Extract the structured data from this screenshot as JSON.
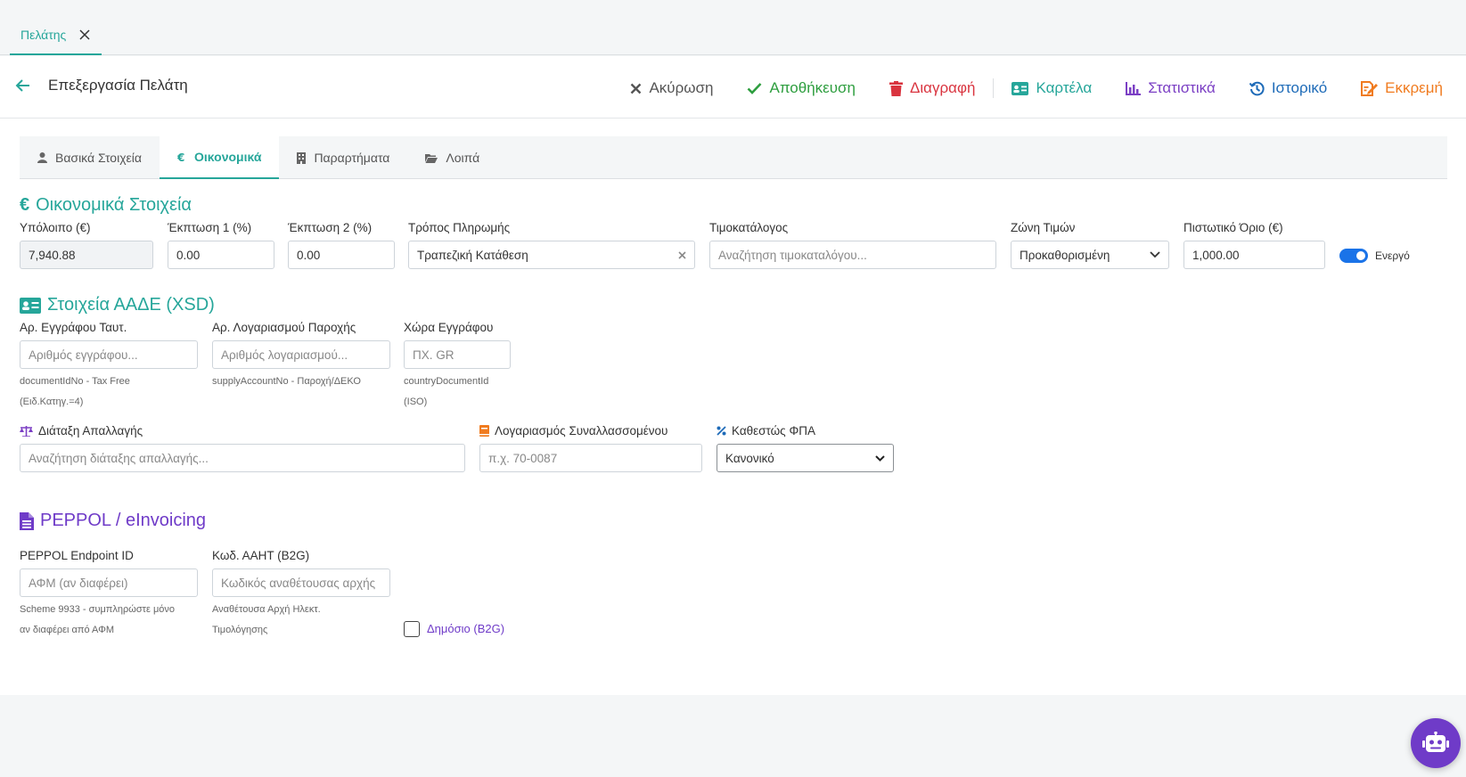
{
  "tabbar": {
    "tab_label": "Πελάτης"
  },
  "header": {
    "title": "Επεξεργασία Πελάτη"
  },
  "actions": [
    {
      "label": "Ακύρωση",
      "color": "#555555",
      "icon": "close-icon"
    },
    {
      "label": "Αποθήκευση",
      "color": "#2e9e3f",
      "icon": "check-icon"
    },
    {
      "label": "Διαγραφή",
      "color": "#d9343f",
      "icon": "trash-icon"
    },
    {
      "label": "Καρτέλα",
      "color": "#26a69a",
      "icon": "id-card-icon"
    },
    {
      "label": "Στατιστικά",
      "color": "#7b3fc4",
      "icon": "bar-chart-icon"
    },
    {
      "label": "Ιστορικό",
      "color": "#1e6bb8",
      "icon": "history-icon"
    },
    {
      "label": "Εκκρεμή",
      "color": "#f07b1f",
      "icon": "pending-icon"
    }
  ],
  "subtabs": [
    {
      "label": "Βασικά Στοιχεία",
      "icon": "user-icon",
      "active": false
    },
    {
      "label": "Οικονομικά",
      "icon": "euro-icon",
      "active": true
    },
    {
      "label": "Παραρτήματα",
      "icon": "building-icon",
      "active": false
    },
    {
      "label": "Λοιπά",
      "icon": "folder-icon",
      "active": false
    }
  ],
  "financial": {
    "title": "Οικονομικά Στοιχεία",
    "balance_label": "Υπόλοιπο (€)",
    "balance_value": "7,940.88",
    "discount1_label": "Έκπτωση 1 (%)",
    "discount1_value": "0.00",
    "discount2_label": "Έκπτωση 2 (%)",
    "discount2_value": "0.00",
    "payment_label": "Τρόπος Πληρωμής",
    "payment_value": "Τραπεζική Κατάθεση",
    "pricelist_label": "Τιμοκατάλογος",
    "pricelist_placeholder": "Αναζήτηση τιμοκαταλόγου...",
    "zone_label": "Ζώνη Τιμών",
    "zone_value": "Προκαθορισμένη",
    "credit_label": "Πιστωτικό Όριο (€)",
    "credit_value": "1,000.00",
    "active_label": "Ενεργό"
  },
  "aade": {
    "title": "Στοιχεία ΑΑΔΕ (XSD)",
    "doc_label": "Αρ. Εγγράφου Ταυτ.",
    "doc_placeholder": "Αριθμός εγγράφου...",
    "doc_help1": "documentIdNo - Tax Free",
    "doc_help2": "(Ειδ.Κατηγ.=4)",
    "supply_label": "Αρ. Λογαριασμού Παροχής",
    "supply_placeholder": "Αριθμός λογαριασμού...",
    "supply_help": "supplyAccountNo - Παροχή/ΔΕΚΟ",
    "country_label": "Χώρα Εγγράφου",
    "country_placeholder": "ΠΧ. GR",
    "country_help1": "countryDocumentId",
    "country_help2": "(ISO)",
    "exemption_label": "Διάταξη Απαλλαγής",
    "exemption_placeholder": "Αναζήτηση διάταξης απαλλαγής...",
    "account_label": "Λογαριασμός Συναλλασσομένου",
    "account_placeholder": "π.χ. 70-0087",
    "vat_label": "Καθεστώς ΦΠΑ",
    "vat_value": "Κανονικό",
    "vat_options": [
      "Κανονικό"
    ]
  },
  "peppol": {
    "title": "PEPPOL / eInvoicing",
    "endpoint_label": "PEPPOL Endpoint ID",
    "endpoint_placeholder": "ΑΦΜ (αν διαφέρει)",
    "endpoint_help1": "Scheme 9933 - συμπληρώστε μόνο",
    "endpoint_help2": "αν διαφέρει από ΑΦΜ",
    "aaht_label": "Κωδ. ΑΑΗΤ (B2G)",
    "aaht_placeholder": "Κωδικός αναθέτουσας αρχής",
    "aaht_help1": "Αναθέτουσα Αρχή Ηλεκτ.",
    "aaht_help2": "Τιμολόγησης",
    "public_label": "Δημόσιο (B2G)"
  },
  "colors": {
    "teal": "#26a69a",
    "purple": "#6f3bc8",
    "blue": "#1a73e8"
  }
}
